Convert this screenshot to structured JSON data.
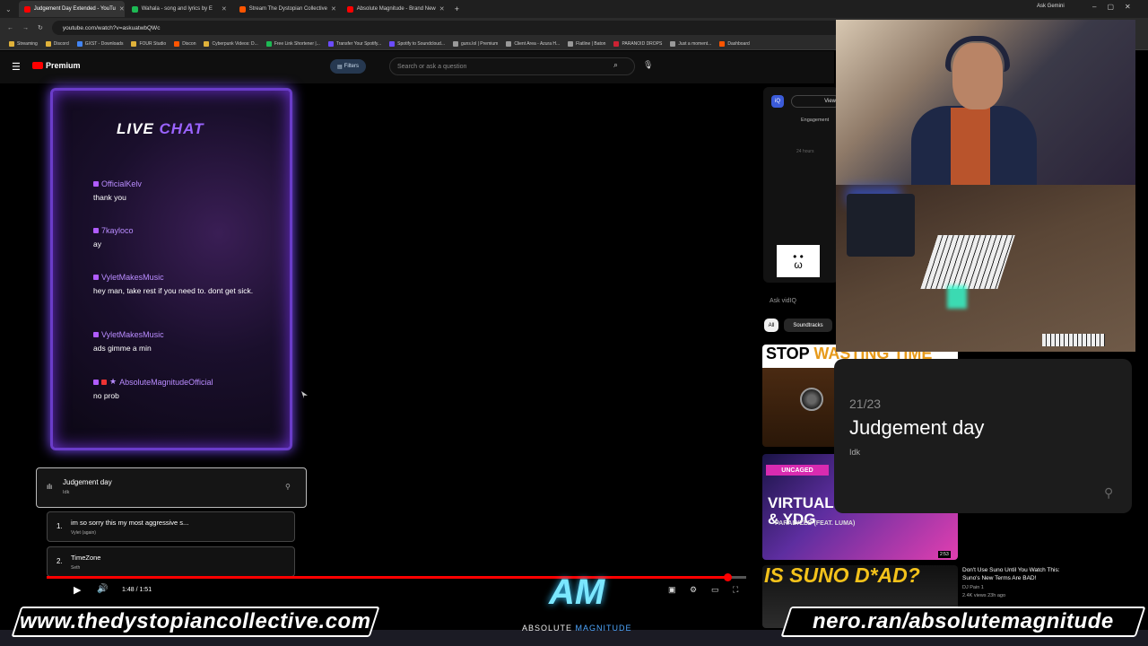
{
  "browser": {
    "tabs": [
      {
        "label": "Judgement Day Extended - YouTu",
        "color": "#ff0000",
        "active": true
      },
      {
        "label": "Wahala - song and lyrics by E",
        "color": "#1db954",
        "active": false
      },
      {
        "label": "Stream The Dystopian Collective",
        "color": "#ff5500",
        "active": false
      },
      {
        "label": "Absolute Magnitude - Brand New",
        "color": "#ff0000",
        "active": false
      }
    ],
    "new_tab": "+",
    "ask_gemini": "Ask Gemini",
    "url": "youtube.com/watch?v=askuatwbQWc",
    "bookmarks": [
      {
        "label": "Streaming",
        "color": "#e0b23a"
      },
      {
        "label": "Discord",
        "color": "#e0b23a"
      },
      {
        "label": "GXST - Downloads",
        "color": "#4285f4"
      },
      {
        "label": "FOUR Studio",
        "color": "#e0b23a"
      },
      {
        "label": "Discon",
        "color": "#ff5500"
      },
      {
        "label": "Cyberpunk Videos: D...",
        "color": "#e0b23a"
      },
      {
        "label": "Free Link Shortener |...",
        "color": "#1db954"
      },
      {
        "label": "Transfer Your Spotify...",
        "color": "#6b4cff"
      },
      {
        "label": "Spotify to Soundcloud...",
        "color": "#6b4cff"
      },
      {
        "label": "guns.lol | Premium",
        "color": "#999999"
      },
      {
        "label": "Client Area - Azura H...",
        "color": "#999999"
      },
      {
        "label": "Flatline | Baton",
        "color": "#999999"
      },
      {
        "label": "PARANOID DROPS",
        "color": "#cc2233"
      },
      {
        "label": "Just a moment...",
        "color": "#999999"
      },
      {
        "label": "Dashboard",
        "color": "#ff5500"
      }
    ]
  },
  "youtube": {
    "brand": "Premium",
    "filters": "Filters",
    "search_placeholder": "Search or ask a question"
  },
  "chat": {
    "title_white": "LIVE",
    "title_purple": "CHAT",
    "messages": [
      {
        "user": "OfficialKelv",
        "text": "thank you"
      },
      {
        "user": "7kayloco",
        "text": "ay"
      },
      {
        "user": "VyletMakesMusic",
        "text": "hey man, take rest if you need to. dont get sick."
      },
      {
        "user": "VyletMakesMusic",
        "text": "ads gimme a min"
      },
      {
        "user": "AbsoluteMagnitudeOfficial",
        "text": "no prob"
      }
    ]
  },
  "playlist": {
    "now_playing": {
      "title": "Judgement day",
      "artist": "Idk"
    },
    "tracks": [
      {
        "num": "1.",
        "title": "im so sorry this my most aggressive s...",
        "artist": "Vylet (again)"
      },
      {
        "num": "2.",
        "title": "TimeZone",
        "artist": "Seth"
      }
    ]
  },
  "player": {
    "time": "1:48 / 1:51",
    "progress": 0.973
  },
  "sidebar": {
    "iq_logo": "iQ",
    "view": "View",
    "engagement": "Engagement",
    "hours": "24 hours",
    "face": "• •\nω",
    "ask": "Ask vidIQ",
    "chip_all": "All",
    "chip_soundtracks": "Soundtracks",
    "video1": {
      "title_white": "STOP ",
      "title_orange": "WASTING TIME"
    },
    "video2": {
      "badge": "UNCAGED",
      "title": "VIRTUAL\n& YDG",
      "subtitle": "PARALYZED (FEAT. LUMA)",
      "duration": "2:53"
    },
    "video3": {
      "thumb_text": "IS SUNO D*AD?",
      "title": "Don't Use Suno Until You Watch This: Suno's New Terms Are BAD!",
      "channel": "DJ Pain 1",
      "meta": "2.4K views  23h ago"
    }
  },
  "now_playing_card": {
    "count": "21/23",
    "title": "Judgement day",
    "artist": "Idk"
  },
  "branding": {
    "left_url": "www.thedystopiancollective.com",
    "right_url": "nero.ran/absolutemagnitude",
    "logo": "AM",
    "logo_text_a": "ABSOLUTE",
    "logo_text_b": "MAGNITUDE"
  }
}
